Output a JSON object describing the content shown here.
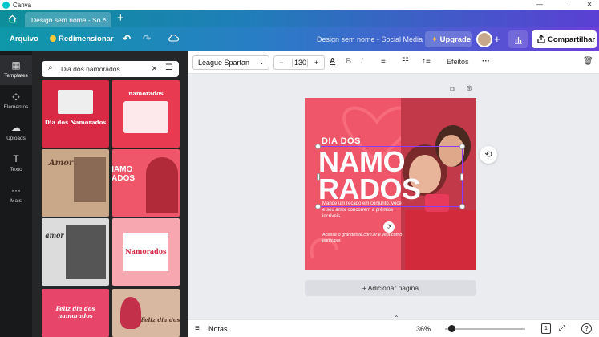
{
  "window": {
    "title": "Canva",
    "minimize": "—",
    "maximize": "☐",
    "close": "✕"
  },
  "tab": {
    "label": "Design sem nome - So...",
    "close": "×"
  },
  "header": {
    "file_menu": "Arquivo",
    "resize": "Redimensionar",
    "doc_title": "Design sem nome - Social Media",
    "upgrade": "Upgrade",
    "share": "Compartilhar"
  },
  "rail": {
    "items": [
      {
        "label": "Templates",
        "icon": "▦"
      },
      {
        "label": "Elementos",
        "icon": "◇"
      },
      {
        "label": "Uploads",
        "icon": "☁"
      },
      {
        "label": "Texto",
        "icon": "T"
      },
      {
        "label": "Mais",
        "icon": "···"
      }
    ]
  },
  "search": {
    "value": "Dia dos namorados"
  },
  "templates": [
    {
      "text": "Dia dos Namorados",
      "bg": "#d92a45"
    },
    {
      "text": "namorados",
      "bg": "#e83a50"
    },
    {
      "text": "Amor",
      "bg": "#c9a88a"
    },
    {
      "text": "NAMO RADOS",
      "bg": "#f0566a"
    },
    {
      "text": "amor",
      "bg": "#dcdcdc"
    },
    {
      "text": "Namorados",
      "bg": "#f6a7b0"
    },
    {
      "text": "Feliz dia dos namorados",
      "bg": "#e8456a"
    },
    {
      "text": "Feliz dia dos",
      "bg": "#d8b8a0"
    }
  ],
  "toolbar": {
    "font": "League Spartan",
    "font_size": "130",
    "minus": "−",
    "plus": "+",
    "effects": "Efeitos",
    "more": "···"
  },
  "design": {
    "small_headline": "DIA DOS",
    "line1": "NAMO",
    "line2": "RADOS",
    "body": "Mande um recado em conjunto, você e seu amor concorrem a prêmios incríveis.",
    "contact": "Acesse o grandesite.com.br e veja como participar."
  },
  "canvas": {
    "add_page": "+ Adicionar página"
  },
  "footer": {
    "notes": "Notas",
    "zoom": "36%",
    "zoom_level": 0.36,
    "page": "1",
    "help": "?"
  },
  "colors": {
    "accent": "#8b3dff",
    "design_bg": "#f0566a",
    "panel_bg": "#252627",
    "rail_bg": "#18191b"
  }
}
